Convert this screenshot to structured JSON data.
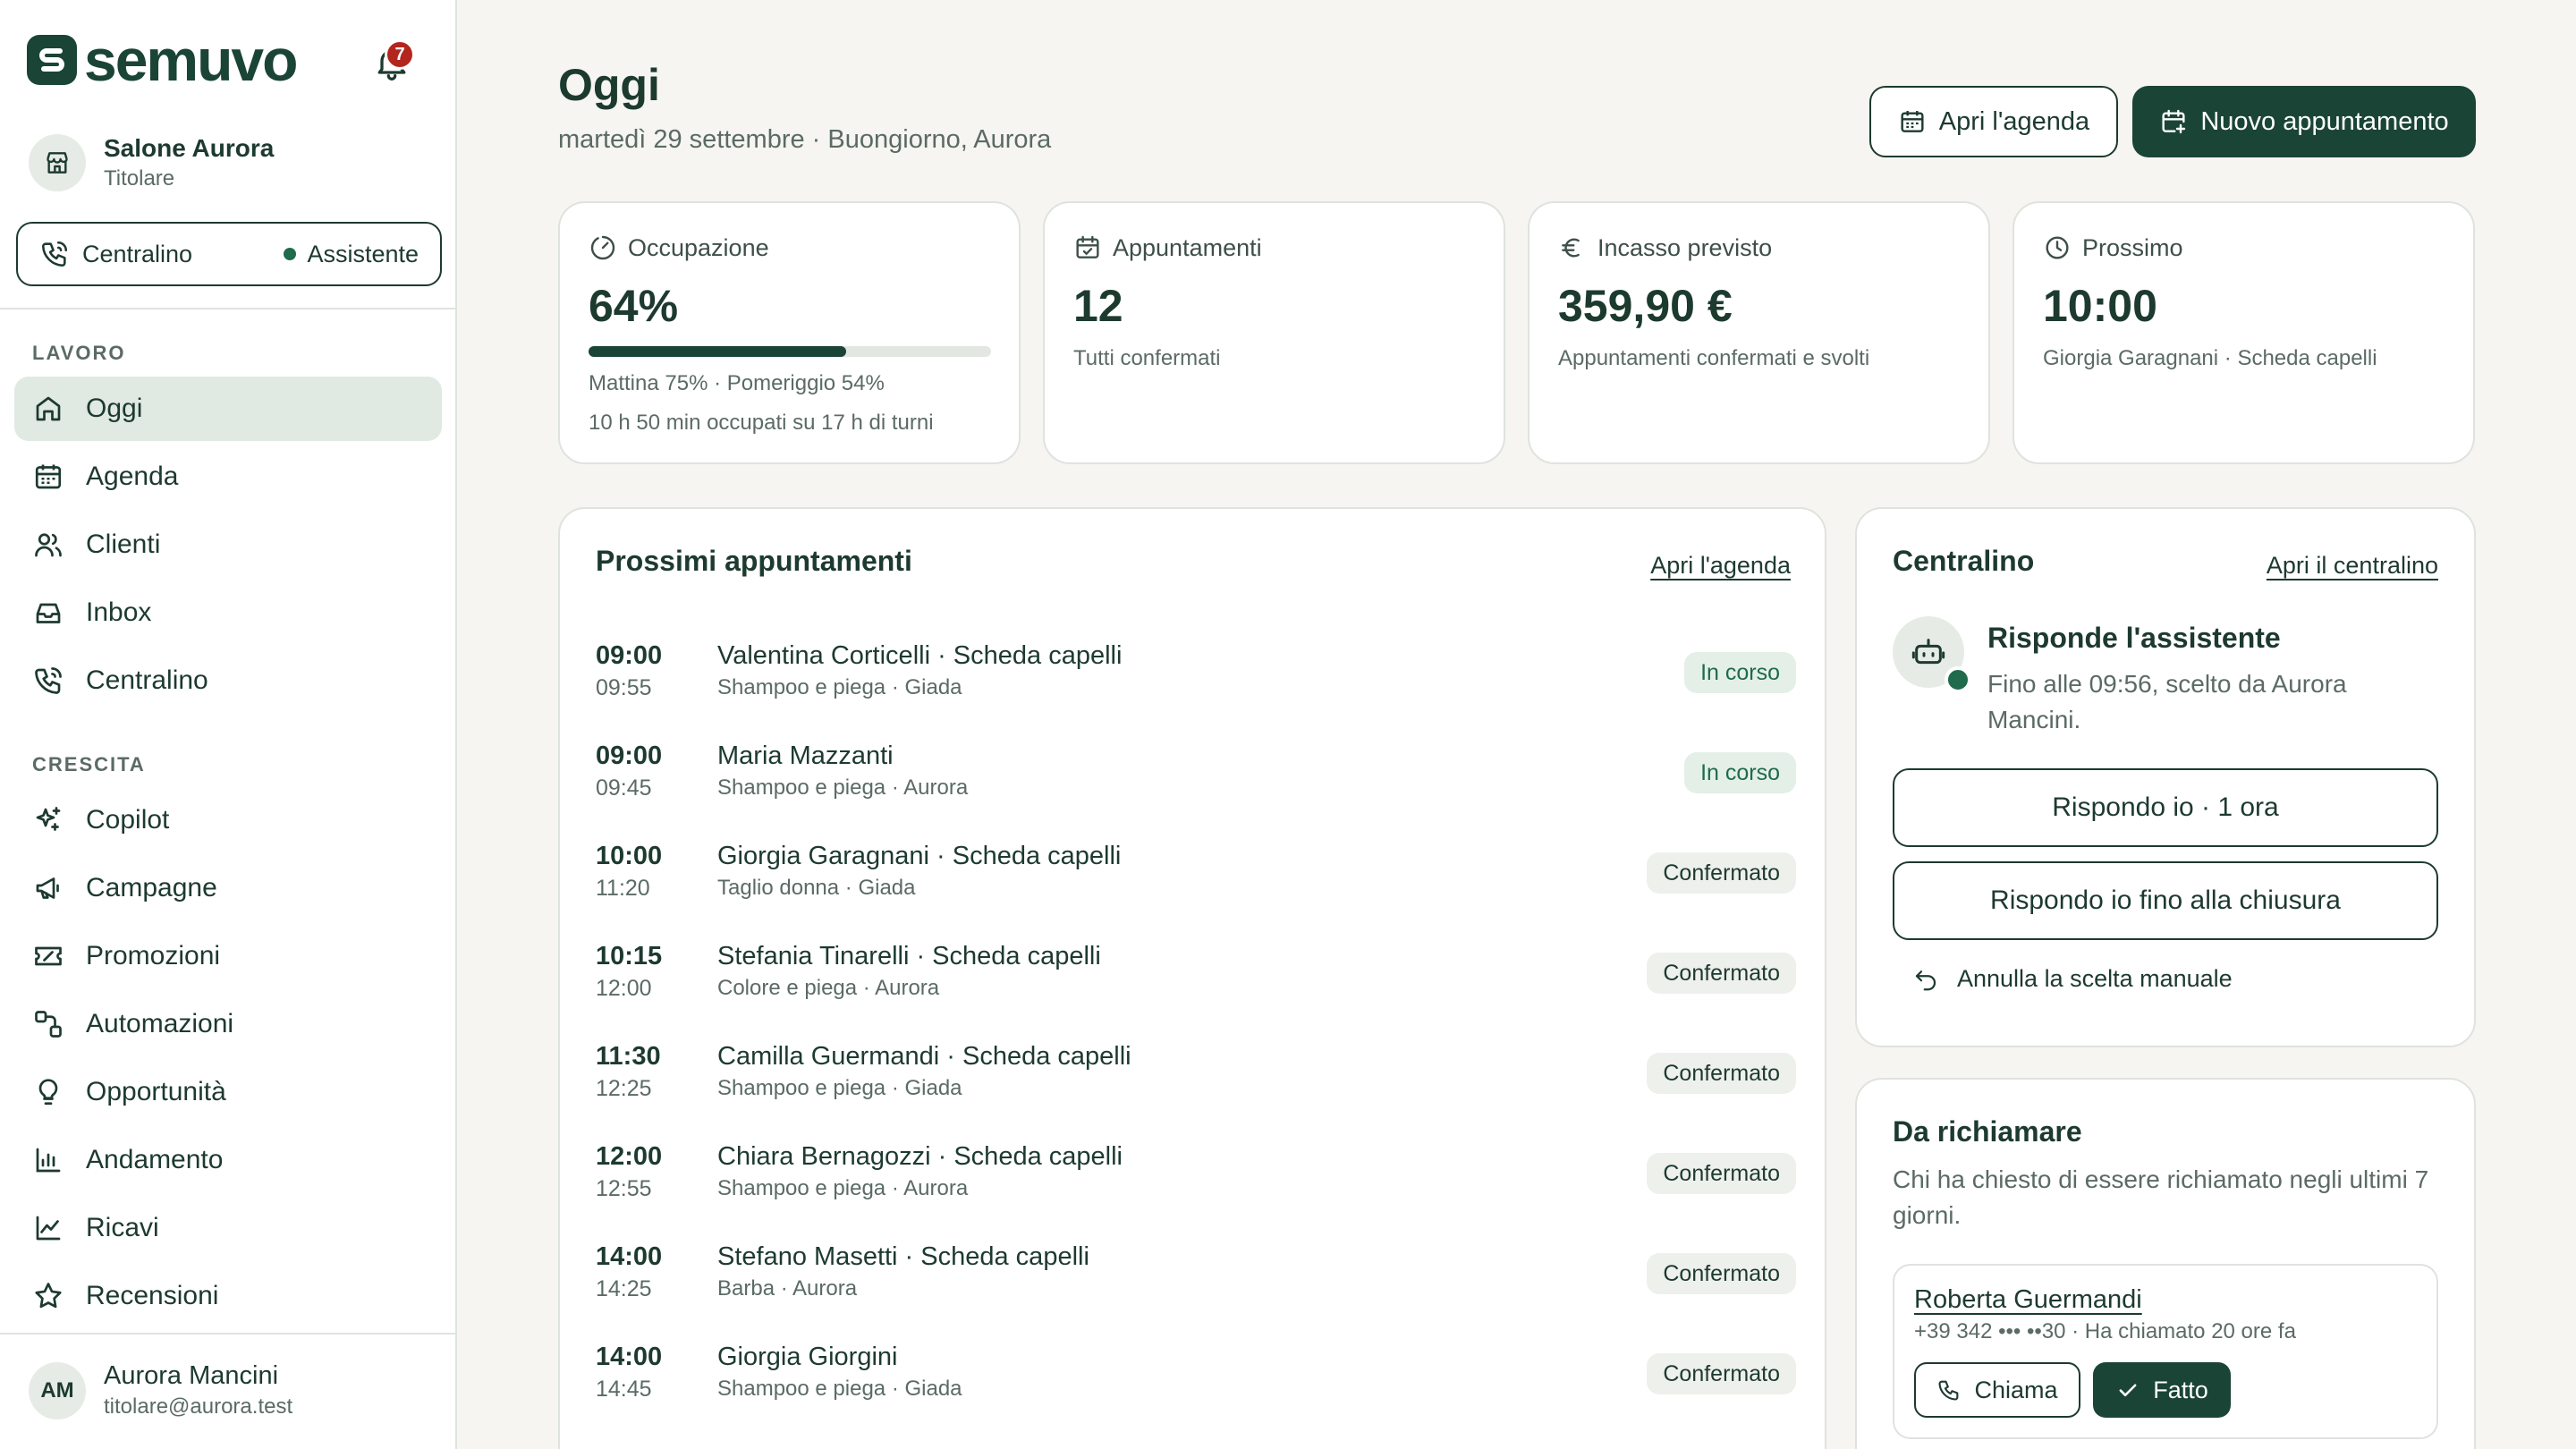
{
  "brand": {
    "name": "semuvo",
    "notification_count": "7"
  },
  "salon": {
    "name": "Salone Aurora",
    "role": "Titolare"
  },
  "switch": {
    "label": "Centralino",
    "status": "Assistente"
  },
  "nav": {
    "section_work": "LAVORO",
    "section_growth": "CRESCITA",
    "work_items": [
      "Oggi",
      "Agenda",
      "Clienti",
      "Inbox",
      "Centralino"
    ],
    "growth_items": [
      "Copilot",
      "Campagne",
      "Promozioni",
      "Automazioni",
      "Opportunità",
      "Andamento",
      "Ricavi",
      "Recensioni"
    ]
  },
  "user": {
    "initials": "AM",
    "name": "Aurora Mancini",
    "email": "titolare@aurora.test"
  },
  "header": {
    "title": "Oggi",
    "subtitle": "martedì 29 settembre · Buongiorno, Aurora",
    "open_agenda": "Apri l'agenda",
    "new_appointment": "Nuovo appuntamento"
  },
  "stats": {
    "occupancy": {
      "label": "Occupazione",
      "value": "64%",
      "fill": 0.64,
      "note1": "Mattina 75% · Pomeriggio 54%",
      "note2": "10 h 50 min occupati su 17 h di turni"
    },
    "appointments": {
      "label": "Appuntamenti",
      "value": "12",
      "note": "Tutti confermati"
    },
    "revenue": {
      "label": "Incasso previsto",
      "value": "359,90 €",
      "note": "Appuntamenti confermati e svolti"
    },
    "next": {
      "label": "Prossimo",
      "value": "10:00",
      "note": "Giorgia Garagnani · Scheda capelli"
    }
  },
  "upcoming": {
    "title": "Prossimi appuntamenti",
    "link": "Apri l'agenda",
    "items": [
      {
        "start": "09:00",
        "end": "09:55",
        "name": "Valentina Corticelli · Scheda capelli",
        "detail": "Shampoo e piega · Giada",
        "status": "In corso"
      },
      {
        "start": "09:00",
        "end": "09:45",
        "name": "Maria Mazzanti",
        "detail": "Shampoo e piega · Aurora",
        "status": "In corso"
      },
      {
        "start": "10:00",
        "end": "11:20",
        "name": "Giorgia Garagnani · Scheda capelli",
        "detail": "Taglio donna · Giada",
        "status": "Confermato"
      },
      {
        "start": "10:15",
        "end": "12:00",
        "name": "Stefania Tinarelli · Scheda capelli",
        "detail": "Colore e piega · Aurora",
        "status": "Confermato"
      },
      {
        "start": "11:30",
        "end": "12:25",
        "name": "Camilla Guermandi · Scheda capelli",
        "detail": "Shampoo e piega · Giada",
        "status": "Confermato"
      },
      {
        "start": "12:00",
        "end": "12:55",
        "name": "Chiara Bernagozzi · Scheda capelli",
        "detail": "Shampoo e piega · Aurora",
        "status": "Confermato"
      },
      {
        "start": "14:00",
        "end": "14:25",
        "name": "Stefano Masetti · Scheda capelli",
        "detail": "Barba · Aurora",
        "status": "Confermato"
      },
      {
        "start": "14:00",
        "end": "14:45",
        "name": "Giorgia Giorgini",
        "detail": "Shampoo e piega · Giada",
        "status": "Confermato"
      }
    ]
  },
  "switchboard": {
    "title": "Centralino",
    "link": "Apri il centralino",
    "heading": "Risponde l'assistente",
    "text": "Fino alle 09:56, scelto da Aurora Mancini.",
    "btn_hour": "Rispondo io · 1 ora",
    "btn_close": "Rispondo io fino alla chiusura",
    "undo": "Annulla la scelta manuale"
  },
  "callbacks": {
    "title": "Da richiamare",
    "desc": "Chi ha chiesto di essere richiamato negli ultimi 7 giorni.",
    "item": {
      "name": "Roberta Guermandi",
      "info": "+39 342 ••• ••30 · Ha chiamato 20 ore fa",
      "call": "Chiama",
      "done": "Fatto"
    }
  },
  "colors": {
    "brand": "#1a4436",
    "accent": "#1f6b4c",
    "badge_alert": "#b3261e"
  }
}
